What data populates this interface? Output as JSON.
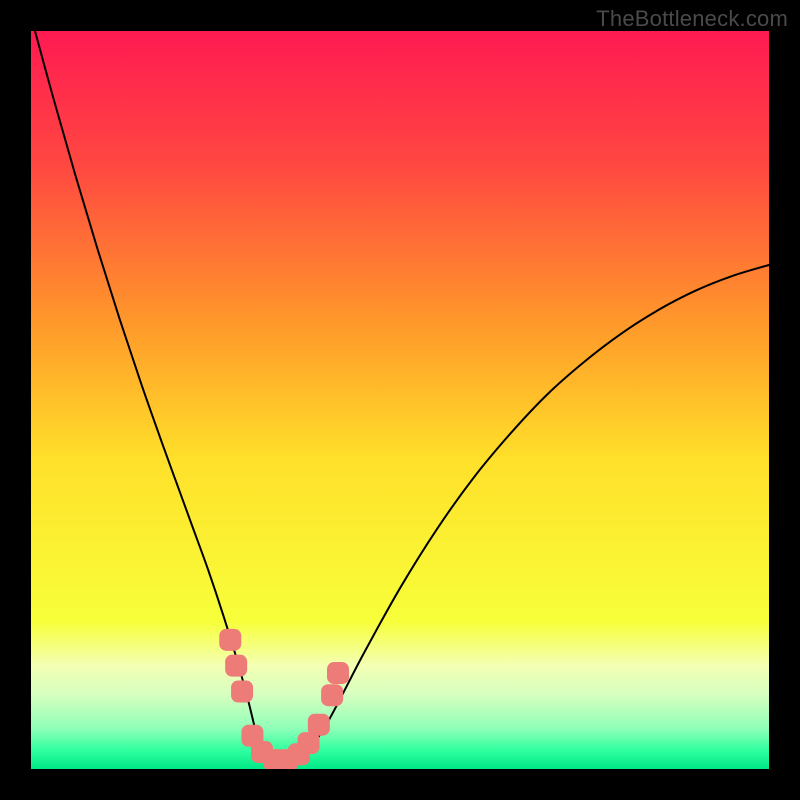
{
  "watermark": "TheBottleneck.com",
  "chart_data": {
    "type": "line",
    "title": "",
    "xlabel": "",
    "ylabel": "",
    "xlim": [
      0,
      100
    ],
    "ylim": [
      0,
      100
    ],
    "grid": false,
    "legend": false,
    "background": {
      "type": "vertical-gradient",
      "stops": [
        {
          "pos": 0.0,
          "color": "#ff1a52"
        },
        {
          "pos": 0.18,
          "color": "#ff4741"
        },
        {
          "pos": 0.4,
          "color": "#ff9a2a"
        },
        {
          "pos": 0.58,
          "color": "#ffe02a"
        },
        {
          "pos": 0.8,
          "color": "#f7ff3a"
        },
        {
          "pos": 0.86,
          "color": "#f3ffb4"
        },
        {
          "pos": 0.9,
          "color": "#d6ffc0"
        },
        {
          "pos": 0.945,
          "color": "#8fffb8"
        },
        {
          "pos": 0.975,
          "color": "#2fff9f"
        },
        {
          "pos": 1.0,
          "color": "#00e887"
        }
      ]
    },
    "series": [
      {
        "name": "bottleneck-curve",
        "color": "#000000",
        "stroke_width": 2,
        "x": [
          0,
          3,
          6,
          9,
          12,
          15,
          18,
          20,
          22,
          24,
          26,
          28,
          29.5,
          30.5,
          31.5,
          33,
          35,
          37,
          40,
          45,
          50,
          55,
          60,
          65,
          70,
          75,
          80,
          85,
          90,
          95,
          100
        ],
        "y": [
          102,
          91,
          80.5,
          70.5,
          61,
          52,
          43.5,
          38,
          32.5,
          27,
          21,
          14.5,
          9,
          5,
          2.5,
          1.2,
          1.0,
          2.0,
          6.0,
          15.5,
          24.5,
          32.5,
          39.5,
          45.5,
          50.8,
          55.2,
          59.0,
          62.2,
          64.8,
          66.8,
          68.3
        ]
      }
    ],
    "markers": {
      "name": "threshold-markers",
      "color": "#ed7b78",
      "shape": "rounded",
      "points": [
        {
          "x": 27.0,
          "y": 17.5
        },
        {
          "x": 27.8,
          "y": 14.0
        },
        {
          "x": 28.6,
          "y": 10.5
        },
        {
          "x": 30.0,
          "y": 4.5
        },
        {
          "x": 31.3,
          "y": 2.3
        },
        {
          "x": 33.0,
          "y": 1.2
        },
        {
          "x": 34.7,
          "y": 1.2
        },
        {
          "x": 36.3,
          "y": 2.0
        },
        {
          "x": 37.6,
          "y": 3.5
        },
        {
          "x": 39.0,
          "y": 6.0
        },
        {
          "x": 40.8,
          "y": 10.0
        },
        {
          "x": 41.6,
          "y": 13.0
        }
      ]
    }
  }
}
